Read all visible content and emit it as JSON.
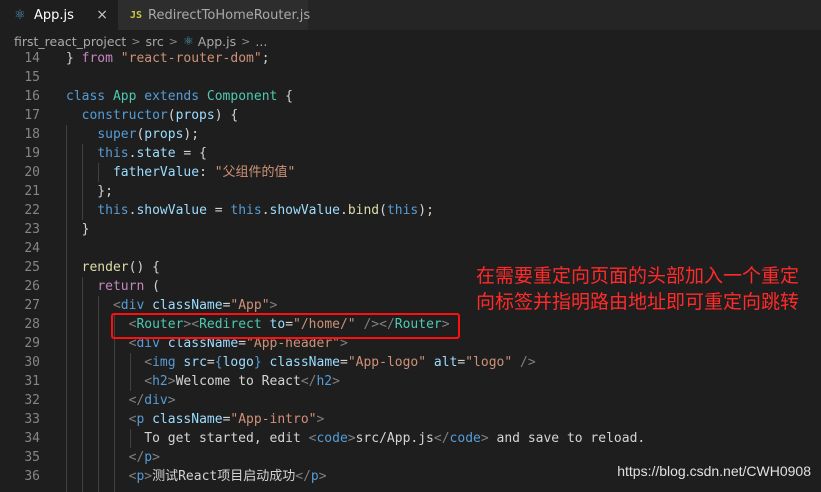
{
  "tabs": [
    {
      "label": "App.js",
      "icon": "react-icon",
      "active": true,
      "close": "×"
    },
    {
      "label": "RedirectToHomeRouter.js",
      "icon": "js-icon",
      "icon_text": "JS",
      "active": false
    }
  ],
  "breadcrumb": {
    "items": [
      "first_react_project",
      "src",
      "App.js",
      "..."
    ]
  },
  "code_lines": [
    {
      "n": "14",
      "html": "<span class=\"p\">} </span><span class=\"k2\">from</span><span class=\"p\"> </span><span class=\"s\">\"react-router-dom\"</span><span class=\"p\">;</span>"
    },
    {
      "n": "15",
      "html": ""
    },
    {
      "n": "16",
      "html": "<span class=\"k\">class</span><span class=\"p\"> </span><span class=\"c\">App</span><span class=\"p\"> </span><span class=\"k\">extends</span><span class=\"p\"> </span><span class=\"c\">Component</span><span class=\"p\"> {</span>"
    },
    {
      "n": "17",
      "html": "<span class=\"p\">  </span><span class=\"k\">constructor</span><span class=\"p\">(</span><span class=\"v\">props</span><span class=\"p\">) {</span>"
    },
    {
      "n": "18",
      "html": "<span class=\"p\">    </span><span class=\"k\">super</span><span class=\"p\">(</span><span class=\"v\">props</span><span class=\"p\">);</span>"
    },
    {
      "n": "19",
      "html": "<span class=\"p\">    </span><span class=\"k\">this</span><span class=\"p\">.</span><span class=\"v\">state</span><span class=\"p\"> = {</span>"
    },
    {
      "n": "20",
      "html": "<span class=\"p\">      </span><span class=\"v\">fatherValue</span><span class=\"p\">: </span><span class=\"s\">\"父组件的值\"</span>"
    },
    {
      "n": "21",
      "html": "<span class=\"p\">    };</span>"
    },
    {
      "n": "22",
      "html": "<span class=\"p\">    </span><span class=\"k\">this</span><span class=\"p\">.</span><span class=\"v\">showValue</span><span class=\"p\"> = </span><span class=\"k\">this</span><span class=\"p\">.</span><span class=\"v\">showValue</span><span class=\"p\">.</span><span class=\"f\">bind</span><span class=\"p\">(</span><span class=\"k\">this</span><span class=\"p\">);</span>"
    },
    {
      "n": "23",
      "html": "<span class=\"p\">  }</span>"
    },
    {
      "n": "24",
      "html": ""
    },
    {
      "n": "25",
      "html": "<span class=\"p\">  </span><span class=\"f\">render</span><span class=\"p\">() {</span>"
    },
    {
      "n": "26",
      "html": "<span class=\"p\">    </span><span class=\"k2\">return</span><span class=\"p\"> (</span>"
    },
    {
      "n": "27",
      "html": "<span class=\"p\">      </span><span class=\"g\">&lt;</span><span class=\"t\">div</span><span class=\"p\"> </span><span class=\"a\">className</span><span class=\"p\">=</span><span class=\"s\">\"App\"</span><span class=\"g\">&gt;</span>"
    },
    {
      "n": "28",
      "html": "<span class=\"p\">        </span><span class=\"g\">&lt;</span><span class=\"c\">Router</span><span class=\"g\">&gt;&lt;</span><span class=\"c\">Redirect</span><span class=\"p\"> </span><span class=\"a\">to</span><span class=\"p\">=</span><span class=\"s\">\"/home/\"</span><span class=\"p\"> </span><span class=\"g\">/&gt;&lt;/</span><span class=\"c\">Router</span><span class=\"g\">&gt;</span>"
    },
    {
      "n": "29",
      "html": "<span class=\"p\">        </span><span class=\"g\">&lt;</span><span class=\"t\">div</span><span class=\"p\"> </span><span class=\"a\">className</span><span class=\"p\">=</span><span class=\"s\">\"App-header\"</span><span class=\"g\">&gt;</span>"
    },
    {
      "n": "30",
      "html": "<span class=\"p\">          </span><span class=\"g\">&lt;</span><span class=\"t\">img</span><span class=\"p\"> </span><span class=\"a\">src</span><span class=\"p\">=</span><span class=\"k\">{</span><span class=\"v\">logo</span><span class=\"k\">}</span><span class=\"p\"> </span><span class=\"a\">className</span><span class=\"p\">=</span><span class=\"s\">\"App-logo\"</span><span class=\"p\"> </span><span class=\"a\">alt</span><span class=\"p\">=</span><span class=\"s\">\"logo\"</span><span class=\"p\"> </span><span class=\"g\">/&gt;</span>"
    },
    {
      "n": "31",
      "html": "<span class=\"p\">          </span><span class=\"g\">&lt;</span><span class=\"t\">h2</span><span class=\"g\">&gt;</span><span class=\"p\">Welcome to React</span><span class=\"g\">&lt;/</span><span class=\"t\">h2</span><span class=\"g\">&gt;</span>"
    },
    {
      "n": "32",
      "html": "<span class=\"p\">        </span><span class=\"g\">&lt;/</span><span class=\"t\">div</span><span class=\"g\">&gt;</span>"
    },
    {
      "n": "33",
      "html": "<span class=\"p\">        </span><span class=\"g\">&lt;</span><span class=\"t\">p</span><span class=\"p\"> </span><span class=\"a\">className</span><span class=\"p\">=</span><span class=\"s\">\"App-intro\"</span><span class=\"g\">&gt;</span>"
    },
    {
      "n": "34",
      "html": "<span class=\"p\">          To get started, edit </span><span class=\"g\">&lt;</span><span class=\"t\">code</span><span class=\"g\">&gt;</span><span class=\"p\">src/App.js</span><span class=\"g\">&lt;/</span><span class=\"t\">code</span><span class=\"g\">&gt;</span><span class=\"p\"> and save to reload.</span>"
    },
    {
      "n": "35",
      "html": "<span class=\"p\">        </span><span class=\"g\">&lt;/</span><span class=\"t\">p</span><span class=\"g\">&gt;</span>"
    },
    {
      "n": "36",
      "html": "<span class=\"p\">        </span><span class=\"g\">&lt;</span><span class=\"t\">p</span><span class=\"g\">&gt;</span><span class=\"p\">测试React项目启动成功</span><span class=\"g\">&lt;/</span><span class=\"t\">p</span><span class=\"g\">&gt;</span>"
    }
  ],
  "annotation": {
    "text": "在需要重定向页面的头部加入一个重定向标签并指明路由地址即可重定向跳转"
  },
  "watermark": "https://blog.csdn.net/CWH0908",
  "colors": {
    "background": "#1e1e1e",
    "highlight_border": "#ff1010",
    "annotation_text": "#ff2a2a"
  }
}
